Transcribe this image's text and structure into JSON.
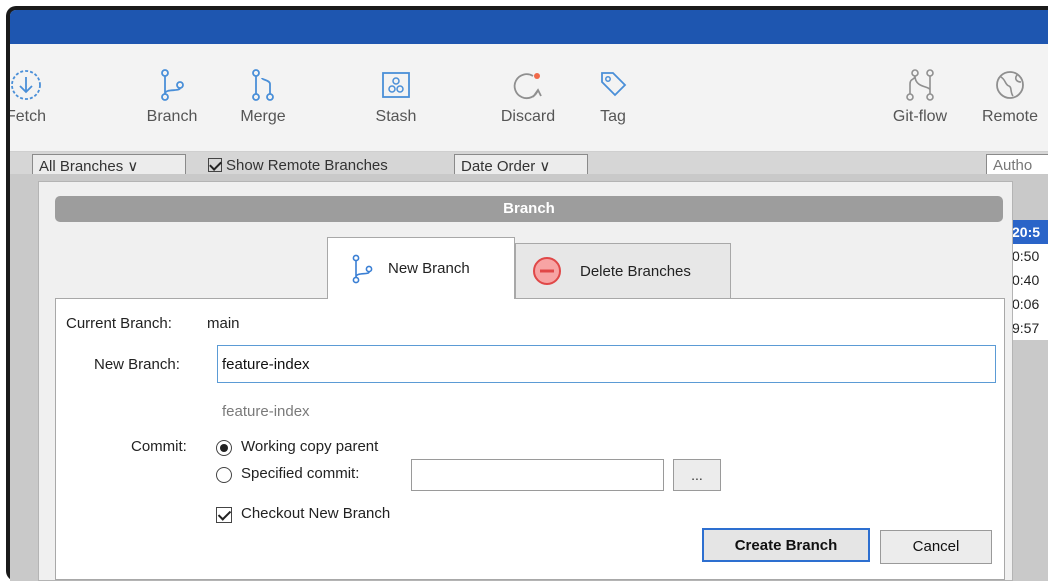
{
  "toolbar": {
    "fetch_label": "Fetch",
    "branch_label": "Branch",
    "merge_label": "Merge",
    "stash_label": "Stash",
    "discard_label": "Discard",
    "tag_label": "Tag",
    "gitflow_label": "Git-flow",
    "remote_label": "Remote"
  },
  "filter_bar": {
    "branches_select": "All Branches ∨",
    "show_remote_label": "Show Remote Branches",
    "order_select": "Date Order ∨",
    "author_search": "Autho"
  },
  "background_times": [
    "20:5",
    "0:50",
    "0:40",
    "0:06",
    "9:57"
  ],
  "dialog": {
    "title": "Branch",
    "tabs": {
      "new_branch": "New Branch",
      "delete_branches": "Delete Branches"
    },
    "current_branch_label": "Current Branch:",
    "current_branch_value": "main",
    "new_branch_label": "New Branch:",
    "new_branch_value": "feature-index",
    "branch_name_hint": "feature-index",
    "commit_label": "Commit:",
    "working_copy_label": "Working copy parent",
    "specified_commit_label": "Specified commit:",
    "specified_commit_value": "",
    "browse_button": "...",
    "checkout_label": "Checkout New Branch",
    "create_button": "Create Branch",
    "cancel_button": "Cancel"
  },
  "colors": {
    "titlebar": "#1e56b0",
    "accent": "#2d6fd0",
    "danger": "#e04848"
  }
}
